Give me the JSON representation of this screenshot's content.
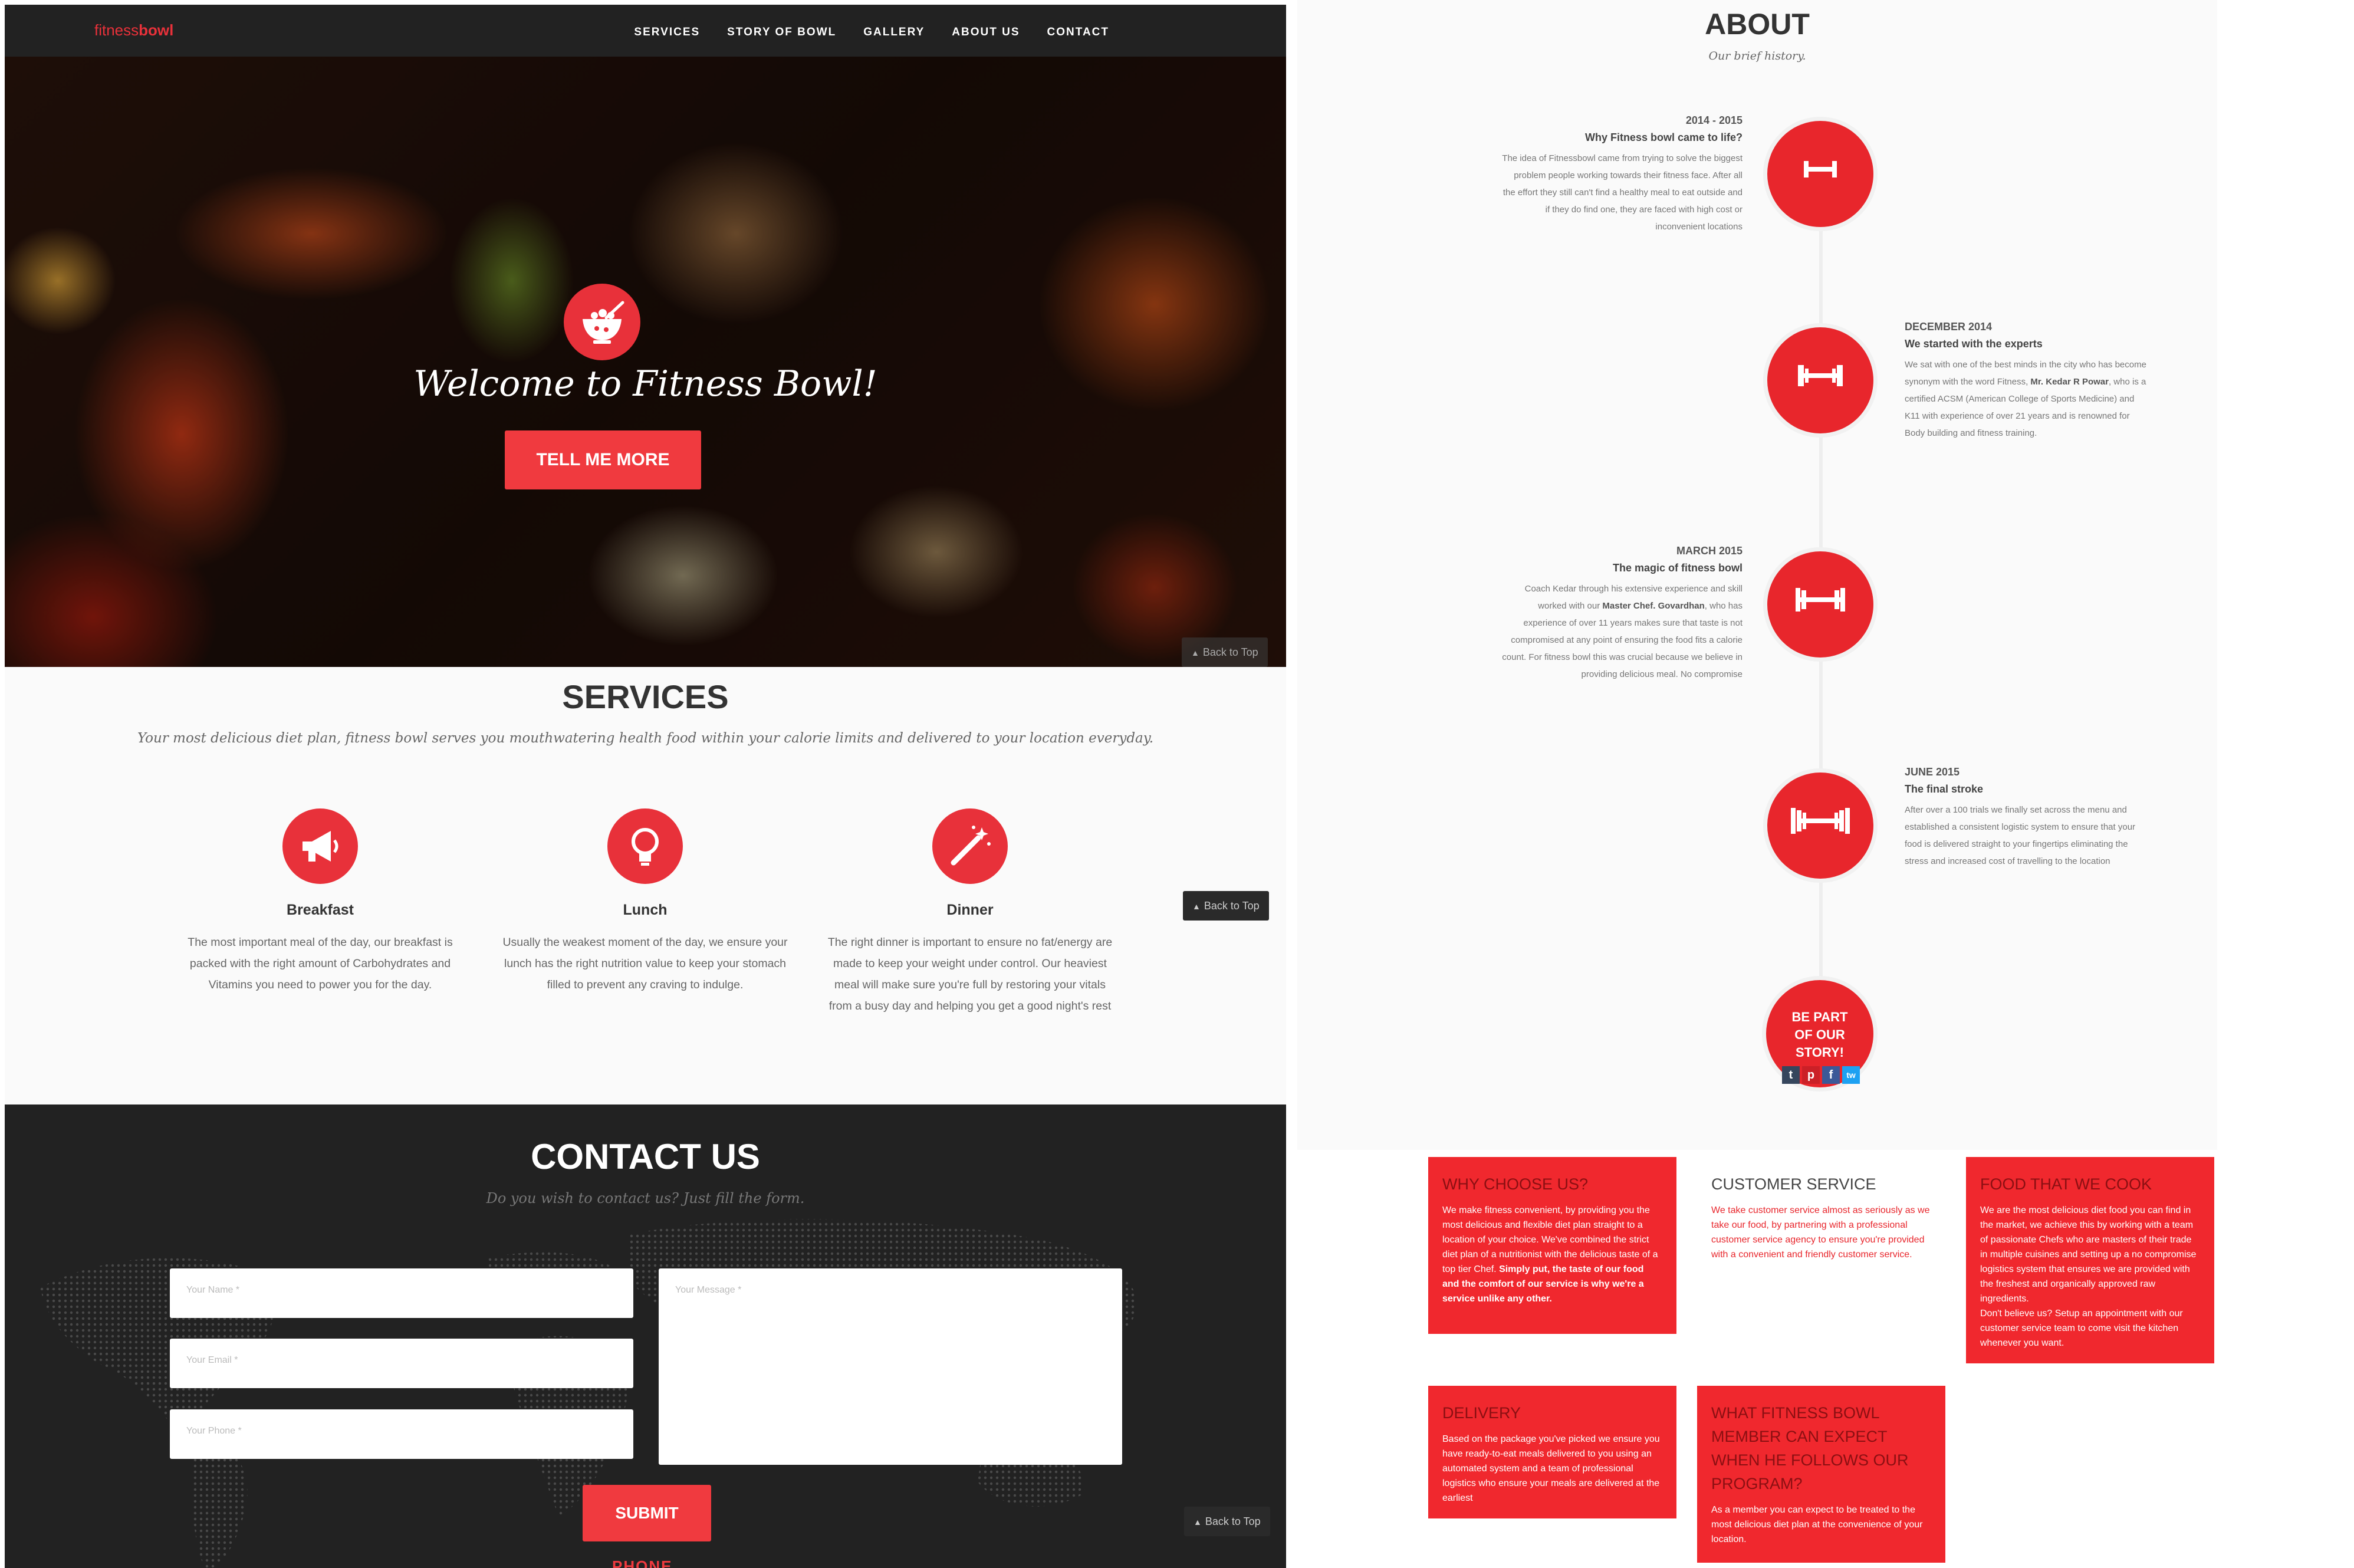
{
  "navbar": {
    "brand_light": "fitness",
    "brand_bold": "bowl",
    "links": [
      "SERVICES",
      "STORY OF BOWL",
      "GALLERY",
      "ABOUT US",
      "CONTACT"
    ]
  },
  "hero": {
    "title": "Welcome to Fitness Bowl!",
    "button": "TELL ME MORE",
    "back_to_top": "Back to Top"
  },
  "services": {
    "title": "SERVICES",
    "subtitle": "Your most delicious diet plan, fitness bowl serves you mouthwatering health food within your calorie limits and delivered to your location everyday.",
    "items": [
      {
        "icon": "megaphone-icon",
        "name": "Breakfast",
        "text": "The most important meal of the day, our breakfast is packed with the right amount of Carbohydrates and Vitamins you need to power you for the day."
      },
      {
        "icon": "lightbulb-icon",
        "name": "Lunch",
        "text": "Usually the weakest moment of the day, we ensure your lunch has the right nutrition value to keep your stomach filled to prevent any craving to indulge."
      },
      {
        "icon": "magic-wand-icon",
        "name": "Dinner",
        "text": "The right dinner is important to ensure no fat/energy are made to keep your weight under control. Our heaviest meal will make sure you're full by restoring your vitals from a busy day and helping you get a good night's rest"
      }
    ],
    "back_to_top": "Back to Top"
  },
  "contact": {
    "title": "CONTACT US",
    "subtitle": "Do you wish to contact us? Just fill the form.",
    "name_placeholder": "Your Name *",
    "email_placeholder": "Your Email *",
    "phone_placeholder": "Your Phone *",
    "message_placeholder": "Your Message *",
    "submit": "SUBMIT",
    "phone_peek": "PHONE",
    "back_to_top": "Back to Top"
  },
  "about": {
    "title": "ABOUT",
    "subtitle": "Our brief history.",
    "timeline": [
      {
        "date": "2014 - 2015",
        "heading": "Why Fitness bowl came to life?",
        "text": "The idea of Fitnessbowl came from trying to solve the biggest problem people working towards their fitness face. After all the effort they still can't find a healthy meal to eat outside and if they do find one, they are faced with high cost or inconvenient locations"
      },
      {
        "date": "DECEMBER 2014",
        "heading": "We started with the experts",
        "text_a": "We sat with one of the best minds in the city who has become synonym with the word Fitness, ",
        "text_b": "Mr. Kedar R Powar",
        "text_c": ", who is a certified ACSM (American College of Sports Medicine) and K11 with experience of over 21 years and is renowned for Body building and fitness training."
      },
      {
        "date": "MARCH 2015",
        "heading": "The magic of fitness bowl",
        "text_a": "Coach Kedar through his extensive experience and skill worked with our ",
        "text_b": "Master Chef. Govardhan",
        "text_c": ", who has experience of over 11 years makes sure that taste is not compromised at any point of ensuring the food fits a calorie count. For fitness bowl this was crucial because we believe in providing delicious meal. No compromise"
      },
      {
        "date": "JUNE 2015",
        "heading": "The final stroke",
        "text": "After over a 100 trials we finally set across the menu and established a consistent logistic system to ensure that your food is delivered straight to your fingertips eliminating the stress and increased cost of travelling to the location"
      }
    ],
    "final_line1": "BE PART",
    "final_line2": "OF OUR",
    "final_line3": "STORY!",
    "social": [
      "t",
      "p",
      "f",
      "tw"
    ]
  },
  "cards": {
    "why": {
      "title": "WHY CHOOSE US?",
      "text": "We make fitness convenient, by providing you the most delicious and flexible diet plan straight to a location of your choice. We've combined the strict diet plan of a nutritionist with the delicious taste of a top tier Chef.",
      "bold": "Simply put, the taste of our food and the comfort of our service is why we're a service unlike any other."
    },
    "customer": {
      "title": "CUSTOMER SERVICE",
      "text": "We take customer service almost as seriously as we take our food, by partnering with a professional customer service agency to ensure you're provided with a convenient and friendly customer service."
    },
    "food": {
      "title": "FOOD THAT WE COOK",
      "text": "We are the most delicious diet food you can find in the market, we achieve this by working with a team of passionate Chefs who are masters of their trade in multiple cuisines and setting up a no compromise logistics system that ensures we are provided with the freshest and organically approved raw ingredients.",
      "text2": "Don't believe us? Setup an appointment with our customer service team to come visit the kitchen whenever you want."
    },
    "delivery": {
      "title": "DELIVERY",
      "text": "Based on the package you've picked we ensure you have ready-to-eat meals delivered to you using an automated system and a team of professional logistics who ensure your meals are delivered at the earliest"
    },
    "member": {
      "title": "WHAT FITNESS BOWL MEMBER CAN EXPECT WHEN HE FOLLOWS OUR PROGRAM?",
      "text": "As a member you can expect to be treated to the most delicious diet plan at the convenience of your location."
    }
  },
  "colors": {
    "accent": "#e8313a",
    "dark": "#222222"
  }
}
